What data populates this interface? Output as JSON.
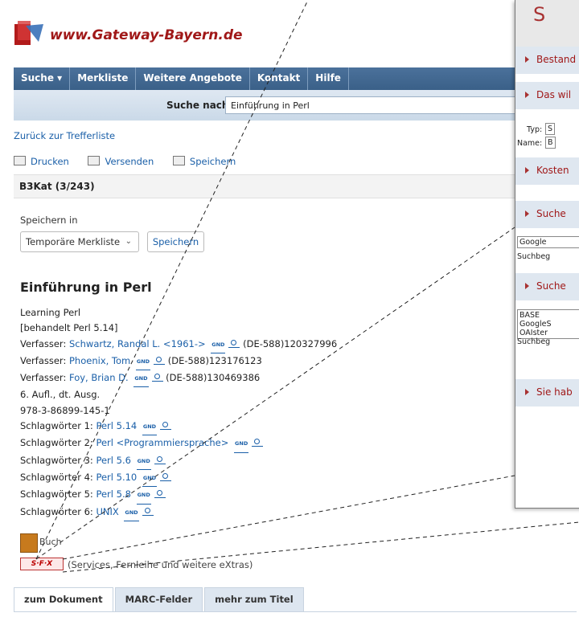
{
  "logo": {
    "text": "www.Gateway-Bayern.de"
  },
  "nav": {
    "items": [
      "Suche ▾",
      "Merkliste",
      "Weitere Angebote",
      "Kontakt",
      "Hilfe"
    ]
  },
  "search": {
    "label": "Suche nach:",
    "value": "Einführung in Perl"
  },
  "back_link": "Zurück zur Trefferliste",
  "actions": {
    "print": "Drucken",
    "send": "Versenden",
    "save": "Speichern"
  },
  "result_count": "B3Kat (3/243)",
  "save_in": {
    "label": "Speichern in",
    "selected": "Temporäre Merkliste",
    "button": "Speichern"
  },
  "record": {
    "title": "Einführung in Perl",
    "subtitle": "Learning Perl",
    "note": "[behandelt Perl 5.14]",
    "authors": [
      {
        "label": "Verfasser:",
        "name": "Schwartz, Randal L. <1961->",
        "gnd": "GND",
        "id": "(DE-588)120327996"
      },
      {
        "label": "Verfasser:",
        "name": "Phoenix, Tom",
        "gnd": "GND",
        "id": "(DE-588)123176123"
      },
      {
        "label": "Verfasser:",
        "name": "Foy, Brian D.",
        "gnd": "GND",
        "id": "(DE-588)130469386"
      }
    ],
    "edition": "6. Aufl., dt. Ausg.",
    "isbn": "978-3-86899-145-1",
    "keywords": [
      {
        "label": "Schlagwörter 1:",
        "value": "Perl 5.14"
      },
      {
        "label": "Schlagwörter 2:",
        "value": "Perl <Programmiersprache>"
      },
      {
        "label": "Schlagwörter 3:",
        "value": "Perl 5.6"
      },
      {
        "label": "Schlagwörter 4:",
        "value": "Perl 5.10"
      },
      {
        "label": "Schlagwörter 5:",
        "value": "Perl 5.8"
      },
      {
        "label": "Schlagwörter 6:",
        "value": "UNIX"
      }
    ],
    "format": "Buch",
    "sfx_logo": "S·F·X",
    "sfx_text": "(Services, Fernleihe und weitere eXtras)"
  },
  "tabs": [
    "zum Dokument",
    "MARC-Felder",
    "mehr zum Titel"
  ],
  "popup": {
    "header": "S",
    "sections": [
      "Bestand",
      "Das wil",
      "Kosten",
      "Suche",
      "Suche",
      "Sie hab"
    ],
    "type_label": "Typ:",
    "type_val": "S",
    "name_label": "Name:",
    "name_val": "B",
    "google": "Google",
    "suchbeg1": "Suchbeg",
    "engines": [
      "BASE",
      "GoogleS",
      "OAIster"
    ],
    "suchbeg2": "Suchbeg",
    "colors": {
      "header_text": "#a83232",
      "section_bg": "#dfe7f0"
    }
  },
  "colors": {
    "nav_bg": "#3a6088",
    "link": "#1a5fa8",
    "brand_red": "#a01818"
  }
}
